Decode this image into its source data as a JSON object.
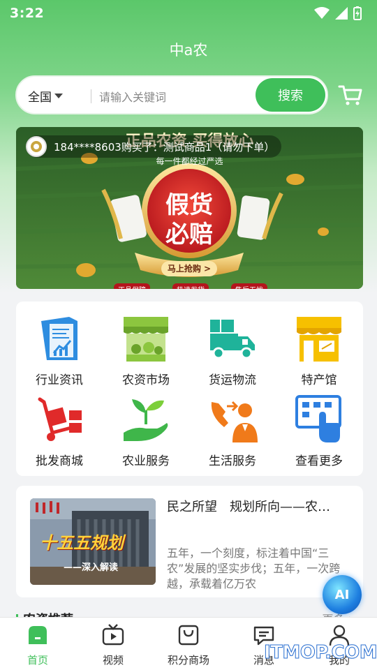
{
  "status_bar": {
    "time": "3:22"
  },
  "app": {
    "title": "中a农"
  },
  "search": {
    "region": "全国",
    "placeholder": "请输入关键词",
    "button": "搜索"
  },
  "banner": {
    "ticker": "184****8603购买了：测试商品1（请勿下单）",
    "headline": "正品农资 买得放心",
    "subline": "每一件都经过严选",
    "badge_line1": "假货",
    "badge_line2": "必赔",
    "cta": "马上抢购 >",
    "tags": [
      "正品保障",
      "极速发货",
      "售后无忧"
    ]
  },
  "categories": [
    {
      "label": "行业资讯",
      "icon": "news-icon"
    },
    {
      "label": "农资市场",
      "icon": "market-stall-icon"
    },
    {
      "label": "货运物流",
      "icon": "truck-icon"
    },
    {
      "label": "特产馆",
      "icon": "shop-icon"
    },
    {
      "label": "批发商城",
      "icon": "hand-truck-icon"
    },
    {
      "label": "农业服务",
      "icon": "sprout-hand-icon"
    },
    {
      "label": "生活服务",
      "icon": "phone-service-icon"
    },
    {
      "label": "查看更多",
      "icon": "more-grid-icon"
    }
  ],
  "news": {
    "title": "民之所望　规划所向——农…",
    "body": "五年，一个刻度，标注着中国“三农”发展的坚实步伐；五年，一次跨越，承载着亿万农",
    "thumb_text": "十五五规划",
    "thumb_sub": "——深入解读"
  },
  "ai_button": "AI",
  "section": {
    "title": "农资推荐",
    "more": "更多 >"
  },
  "tabs": [
    {
      "label": "首页",
      "icon": "home-icon",
      "active": true
    },
    {
      "label": "视频",
      "icon": "tv-icon",
      "active": false
    },
    {
      "label": "积分商场",
      "icon": "bag-icon",
      "active": false
    },
    {
      "label": "消息",
      "icon": "chat-icon",
      "active": false
    },
    {
      "label": "我的",
      "icon": "user-icon",
      "active": false
    }
  ],
  "watermark": "ITMOP.COM",
  "colors": {
    "brand_green": "#3fbf5a",
    "header_green": "#5bc76a"
  }
}
